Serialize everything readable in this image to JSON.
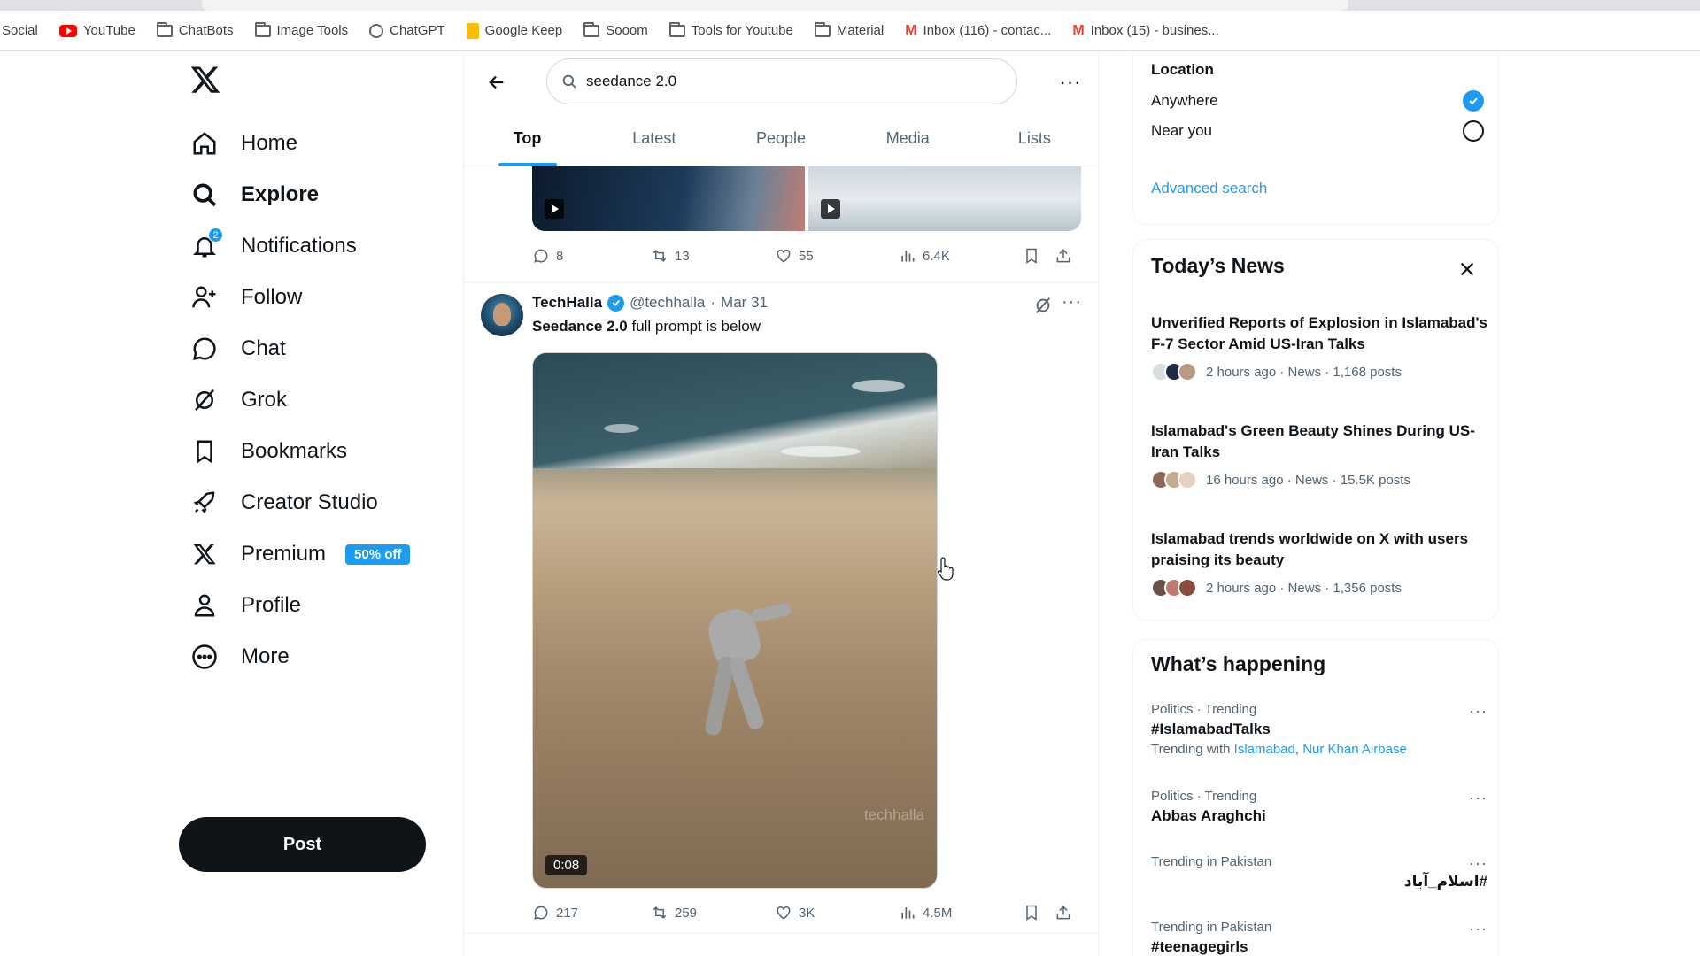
{
  "bookmarks_bar": {
    "items": [
      {
        "label": "Social",
        "icon": "none"
      },
      {
        "label": "YouTube",
        "icon": "youtube-icon"
      },
      {
        "label": "ChatBots",
        "icon": "folder-icon"
      },
      {
        "label": "Image Tools",
        "icon": "folder-icon"
      },
      {
        "label": "ChatGPT",
        "icon": "chatgpt-icon"
      },
      {
        "label": "Google Keep",
        "icon": "keep-icon"
      },
      {
        "label": "Sooom",
        "icon": "folder-icon"
      },
      {
        "label": "Tools for Youtube",
        "icon": "folder-icon"
      },
      {
        "label": "Material",
        "icon": "folder-icon"
      },
      {
        "label": "Inbox (116) - contac...",
        "icon": "gmail-icon"
      },
      {
        "label": "Inbox (15) - busines...",
        "icon": "gmail-icon"
      }
    ]
  },
  "sidebar": {
    "items": [
      {
        "label": "Home",
        "icon": "home-icon"
      },
      {
        "label": "Explore",
        "icon": "search-icon",
        "active": true
      },
      {
        "label": "Notifications",
        "icon": "bell-icon",
        "badge": "2"
      },
      {
        "label": "Follow",
        "icon": "follow-icon"
      },
      {
        "label": "Chat",
        "icon": "chat-icon"
      },
      {
        "label": "Grok",
        "icon": "grok-icon"
      },
      {
        "label": "Bookmarks",
        "icon": "bookmark-icon"
      },
      {
        "label": "Creator Studio",
        "icon": "rocket-icon"
      },
      {
        "label": "Premium",
        "icon": "x-icon",
        "promo": "50% off"
      },
      {
        "label": "Profile",
        "icon": "person-icon"
      },
      {
        "label": "More",
        "icon": "more-circle-icon"
      }
    ],
    "post_label": "Post"
  },
  "search": {
    "query": "seedance 2.0",
    "tabs": [
      {
        "label": "Top",
        "active": true
      },
      {
        "label": "Latest"
      },
      {
        "label": "People"
      },
      {
        "label": "Media"
      },
      {
        "label": "Lists"
      }
    ]
  },
  "previous_tweet": {
    "replies": "8",
    "reposts": "13",
    "likes": "55",
    "views": "6.4K"
  },
  "tweet": {
    "name": "TechHalla",
    "handle": "@techhalla",
    "date": "Mar 31",
    "text_bold": "Seedance 2.0",
    "text_rest": " full prompt is below",
    "video_duration": "0:08",
    "watermark": "techhalla",
    "replies": "217",
    "reposts": "259",
    "likes": "3K",
    "views": "4.5M"
  },
  "location_filter": {
    "title": "Location",
    "options": [
      {
        "label": "Anywhere",
        "selected": true
      },
      {
        "label": "Near you",
        "selected": false
      }
    ],
    "advanced_link": "Advanced search"
  },
  "todays_news": {
    "title": "Today’s News",
    "items": [
      {
        "headline": "Unverified Reports of Explosion in Islamabad's F-7 Sector Amid US-Iran Talks",
        "meta": "2 hours ago · News · 1,168 posts"
      },
      {
        "headline": "Islamabad's Green Beauty Shines During US-Iran Talks",
        "meta": "16 hours ago · News · 15.5K posts"
      },
      {
        "headline": "Islamabad trends worldwide on X with users praising its beauty",
        "meta": "2 hours ago · News · 1,356 posts"
      }
    ]
  },
  "whats_happening": {
    "title": "What’s happening",
    "trends": [
      {
        "context": "Politics · Trending",
        "name": "#IslamabadTalks",
        "with_prefix": "Trending with ",
        "with_links": [
          "Islamabad",
          "Nur Khan Airbase"
        ]
      },
      {
        "context": "Politics · Trending",
        "name": "Abbas Araghchi"
      },
      {
        "context": "Trending in Pakistan",
        "name": "#اسلام_آباد"
      },
      {
        "context": "Trending in Pakistan",
        "name": "#teenagegirls"
      }
    ]
  },
  "colors": {
    "accent": "#1d9bf0",
    "text": "#0f1419",
    "muted": "#536471"
  }
}
